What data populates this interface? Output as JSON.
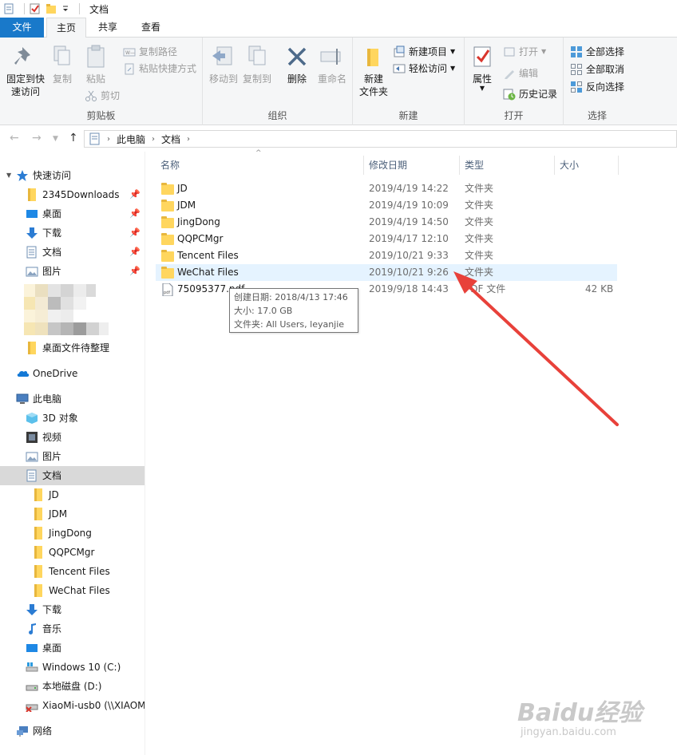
{
  "window": {
    "title": "文档"
  },
  "ribbon_tabs": {
    "file": "文件",
    "home": "主页",
    "share": "共享",
    "view": "查看"
  },
  "ribbon": {
    "clipboard": {
      "label": "剪贴板",
      "pin": "固定到快速访问",
      "copy": "复制",
      "paste": "粘贴",
      "copy_path": "复制路径",
      "paste_shortcut": "粘贴快捷方式",
      "cut": "剪切"
    },
    "organize": {
      "label": "组织",
      "move_to": "移动到",
      "copy_to": "复制到",
      "delete": "删除",
      "rename": "重命名"
    },
    "new": {
      "label": "新建",
      "new_folder": "新建\n文件夹",
      "new_item": "新建项目",
      "easy_access": "轻松访问"
    },
    "open": {
      "label": "打开",
      "properties": "属性",
      "open": "打开",
      "edit": "编辑",
      "history": "历史记录"
    },
    "select": {
      "label": "选择",
      "select_all": "全部选择",
      "select_none": "全部取消",
      "invert": "反向选择"
    }
  },
  "address": {
    "crumbs": [
      "此电脑",
      "文档"
    ]
  },
  "nav": {
    "quick_access": "快速访问",
    "quick_items": [
      "2345Downloads",
      "桌面",
      "下载",
      "文档",
      "图片"
    ],
    "desktop_folder": "桌面文件待整理",
    "onedrive": "OneDrive",
    "this_pc": "此电脑",
    "pc_items": [
      "3D 对象",
      "视频",
      "图片",
      "文档"
    ],
    "doc_children": [
      "JD",
      "JDM",
      "JingDong",
      "QQPCMgr",
      "Tencent Files",
      "WeChat Files"
    ],
    "pc_items2": [
      "下载",
      "音乐",
      "桌面",
      "Windows 10 (C:)",
      "本地磁盘 (D:)",
      "XiaoMi-usb0 (\\\\XIAOM"
    ],
    "network": "网络"
  },
  "columns": {
    "name": "名称",
    "date": "修改日期",
    "type": "类型",
    "size": "大小"
  },
  "files": [
    {
      "name": "JD",
      "date": "2019/4/19 14:22",
      "type": "文件夹",
      "size": ""
    },
    {
      "name": "JDM",
      "date": "2019/4/19 10:09",
      "type": "文件夹",
      "size": ""
    },
    {
      "name": "JingDong",
      "date": "2019/4/19 14:50",
      "type": "文件夹",
      "size": ""
    },
    {
      "name": "QQPCMgr",
      "date": "2019/4/17 12:10",
      "type": "文件夹",
      "size": ""
    },
    {
      "name": "Tencent Files",
      "date": "2019/10/21 9:33",
      "type": "文件夹",
      "size": ""
    },
    {
      "name": "WeChat Files",
      "date": "2019/10/21 9:26",
      "type": "文件夹",
      "size": ""
    },
    {
      "name": "75095377.pdf",
      "date": "2019/9/18 14:43",
      "type": "PDF 文件",
      "size": "42 KB"
    }
  ],
  "tooltip": {
    "created": "创建日期: 2018/4/13 17:46",
    "size": "大小: 17.0 GB",
    "folders": "文件夹: All Users, leyanjie"
  },
  "watermark": {
    "main": "Baidu经验",
    "sub": "jingyan.baidu.com"
  },
  "colors": {
    "accent": "#1979ca",
    "arrow": "#e8413a",
    "folder": "#ffd65e"
  }
}
